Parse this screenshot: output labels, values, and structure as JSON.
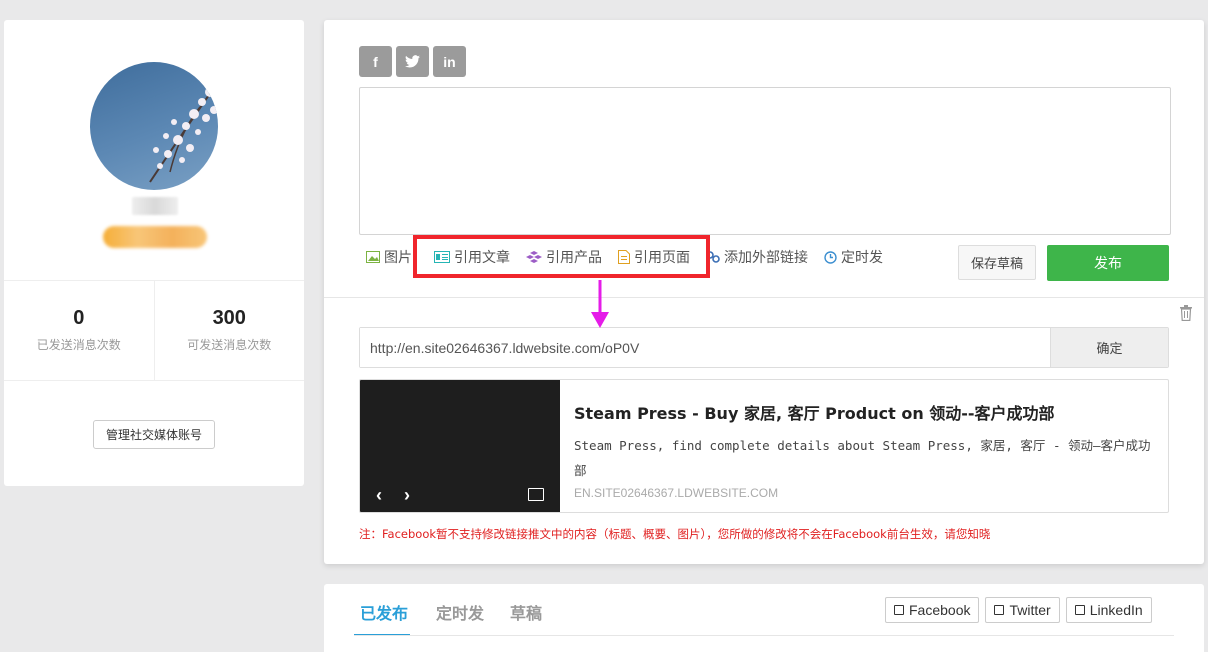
{
  "profile": {
    "stats": [
      {
        "value": "0",
        "label": "已发送消息次数"
      },
      {
        "value": "300",
        "label": "可发送消息次数"
      }
    ],
    "manage_label": "管理社交媒体账号"
  },
  "composer": {
    "social_icons": [
      "f",
      "t",
      "in"
    ],
    "toolbar": [
      {
        "label": "图片",
        "icon": "image-icon",
        "color": "#7cb342"
      },
      {
        "label": "引用文章",
        "icon": "article-icon",
        "color": "#26b5b5"
      },
      {
        "label": "引用产品",
        "icon": "product-icon",
        "color": "#9c5cc6"
      },
      {
        "label": "引用页面",
        "icon": "page-icon",
        "color": "#e0a020"
      },
      {
        "label": "添加外部链接",
        "icon": "link-icon",
        "color": "#3c6fb5"
      },
      {
        "label": "定时发",
        "icon": "clock-icon",
        "color": "#3c8fd0"
      }
    ],
    "save_draft_label": "保存草稿",
    "publish_label": "发布",
    "url_value": "http://en.site02646367.ldwebsite.com/oP0V",
    "confirm_label": "确定",
    "preview": {
      "title": "Steam Press - Buy 家居, 客厅 Product on 领动--客户成功部",
      "description": "Steam Press, find complete details about Steam Press, 家居, 客厅 - 领动—客户成功部",
      "domain": "EN.SITE02646367.LDWEBSITE.COM"
    },
    "note": "注：Facebook暂不支持修改链接推文中的内容（标题、概要、图片），您所做的修改将不会在Facebook前台生效，请您知晓"
  },
  "posts": {
    "tabs": [
      "已发布",
      "定时发",
      "草稿"
    ],
    "active_tab": "已发布",
    "filters": [
      "Facebook",
      "Twitter",
      "LinkedIn"
    ]
  },
  "colors": {
    "publish": "#3eb54a",
    "highlight": "#f0252c",
    "arrow": "#e51ce8",
    "active_tab": "#2a9fd8",
    "note": "#e02020"
  }
}
